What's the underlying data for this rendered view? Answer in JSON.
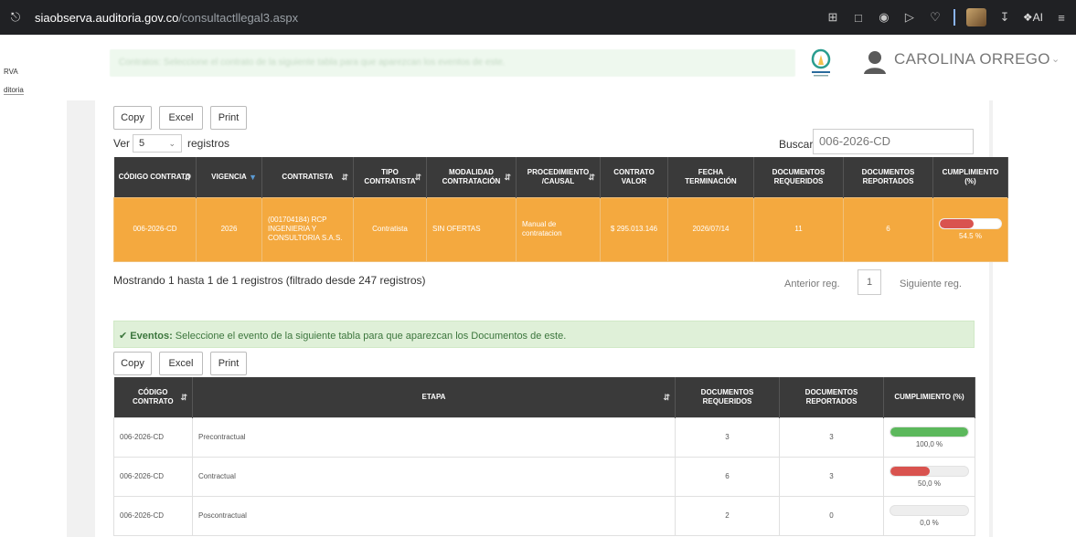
{
  "browser": {
    "url_host": "siaobserva.auditoria.gov.co",
    "url_path": "/consultactllegal3.aspx",
    "ai_label": "AI"
  },
  "sidebar": {
    "line1": "RVA",
    "line2": "ditoria"
  },
  "header": {
    "notice": "Contratos: Seleccione el contrato de la siguiente tabla para que aparezcan los eventos de este.",
    "username": "CAROLINA  ORREGO"
  },
  "toolbar1": {
    "copy": "Copy",
    "excel": "Excel",
    "print": "Print"
  },
  "length": {
    "ver": "Ver",
    "value": "5",
    "registros": "registros"
  },
  "search": {
    "label": "Buscar",
    "value": "006-2026-CD"
  },
  "contracts": {
    "headers": [
      "CÓDIGO CONTRATO",
      "VIGENCIA",
      "CONTRATISTA",
      "TIPO CONTRATISTA",
      "MODALIDAD CONTRATACIÓN",
      "PROCEDIMIENTO /CAUSAL",
      "CONTRATO VALOR",
      "FECHA TERMINACIÓN",
      "DOCUMENTOS REQUERIDOS",
      "DOCUMENTOS REPORTADOS",
      "CUMPLIMIENTO (%)"
    ],
    "row": {
      "codigo": "006-2026-CD",
      "vigencia": "2026",
      "contratista": "(001704184) RCP INGENIERIA Y CONSULTORIA S.A.S.",
      "tipo": "Contratista",
      "modalidad": "SIN OFERTAS",
      "procedimiento": "Manual de contratacion",
      "valor": "$ 295.013.146",
      "fecha": "2026/07/14",
      "requeridos": "11",
      "reportados": "6",
      "cumplimiento": "54.5 %",
      "cumplimiento_value": 54.5
    }
  },
  "info1": "Mostrando 1 hasta 1 de 1 registros (filtrado desde 247 registros)",
  "pager": {
    "prev": "Anterior reg.",
    "page": "1",
    "next": "Siguiente reg."
  },
  "eventos_alert": {
    "title": "Eventos:",
    "text": " Seleccione el evento de la siguiente tabla para que aparezcan los Documentos de este."
  },
  "toolbar2": {
    "copy": "Copy",
    "excel": "Excel",
    "print": "Print"
  },
  "events": {
    "headers": [
      "CÓDIGO CONTRATO",
      "ETAPA",
      "DOCUMENTOS REQUERIDOS",
      "DOCUMENTOS REPORTADOS",
      "CUMPLIMIENTO (%)"
    ],
    "rows": [
      {
        "codigo": "006-2026-CD",
        "etapa": "Precontractual",
        "requeridos": "3",
        "reportados": "3",
        "pct_label": "100,0 %",
        "pct": 100,
        "color": "#5cb85c"
      },
      {
        "codigo": "006-2026-CD",
        "etapa": "Contractual",
        "requeridos": "6",
        "reportados": "3",
        "pct_label": "50,0 %",
        "pct": 50,
        "color": "#d9534f"
      },
      {
        "codigo": "006-2026-CD",
        "etapa": "Poscontractual",
        "requeridos": "2",
        "reportados": "0",
        "pct_label": "0,0 %",
        "pct": 0,
        "color": "#d9534f"
      }
    ]
  },
  "colors": {
    "accent_row": "#f4a93f",
    "header_bg": "#3a3a3a",
    "success": "#5cb85c",
    "danger": "#d9534f"
  }
}
